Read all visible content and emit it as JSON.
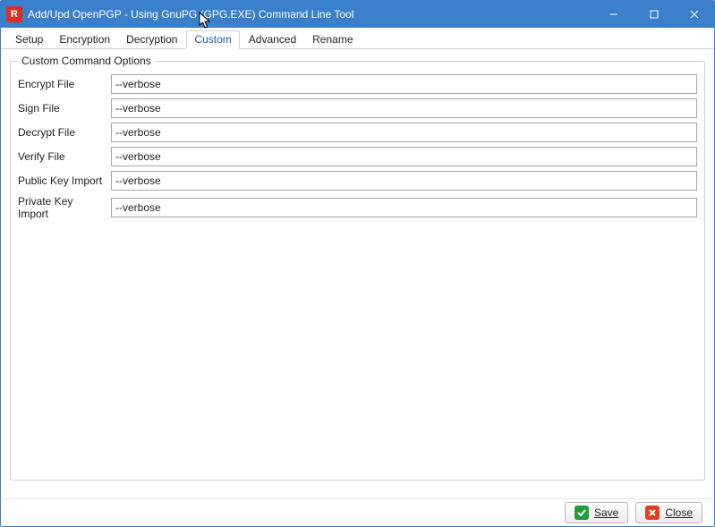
{
  "window": {
    "title": "Add/Upd OpenPGP - Using GnuPG (GPG.EXE) Command Line Tool",
    "app_icon_letter": "R"
  },
  "tabs": {
    "setup": "Setup",
    "encryption": "Encryption",
    "decryption": "Decryption",
    "custom": "Custom",
    "advanced": "Advanced",
    "rename": "Rename"
  },
  "group": {
    "legend": "Custom Command Options",
    "rows": {
      "encrypt": {
        "label": "Encrypt File",
        "value": "--verbose"
      },
      "sign": {
        "label": "Sign File",
        "value": "--verbose"
      },
      "decrypt": {
        "label": "Decrypt File",
        "value": "--verbose"
      },
      "verify": {
        "label": "Verify File",
        "value": "--verbose"
      },
      "pubkey": {
        "label": "Public Key Import",
        "value": "--verbose"
      },
      "privkey": {
        "label": "Private Key Import",
        "value": "--verbose"
      }
    }
  },
  "footer": {
    "save": "Save",
    "close": "Close"
  }
}
